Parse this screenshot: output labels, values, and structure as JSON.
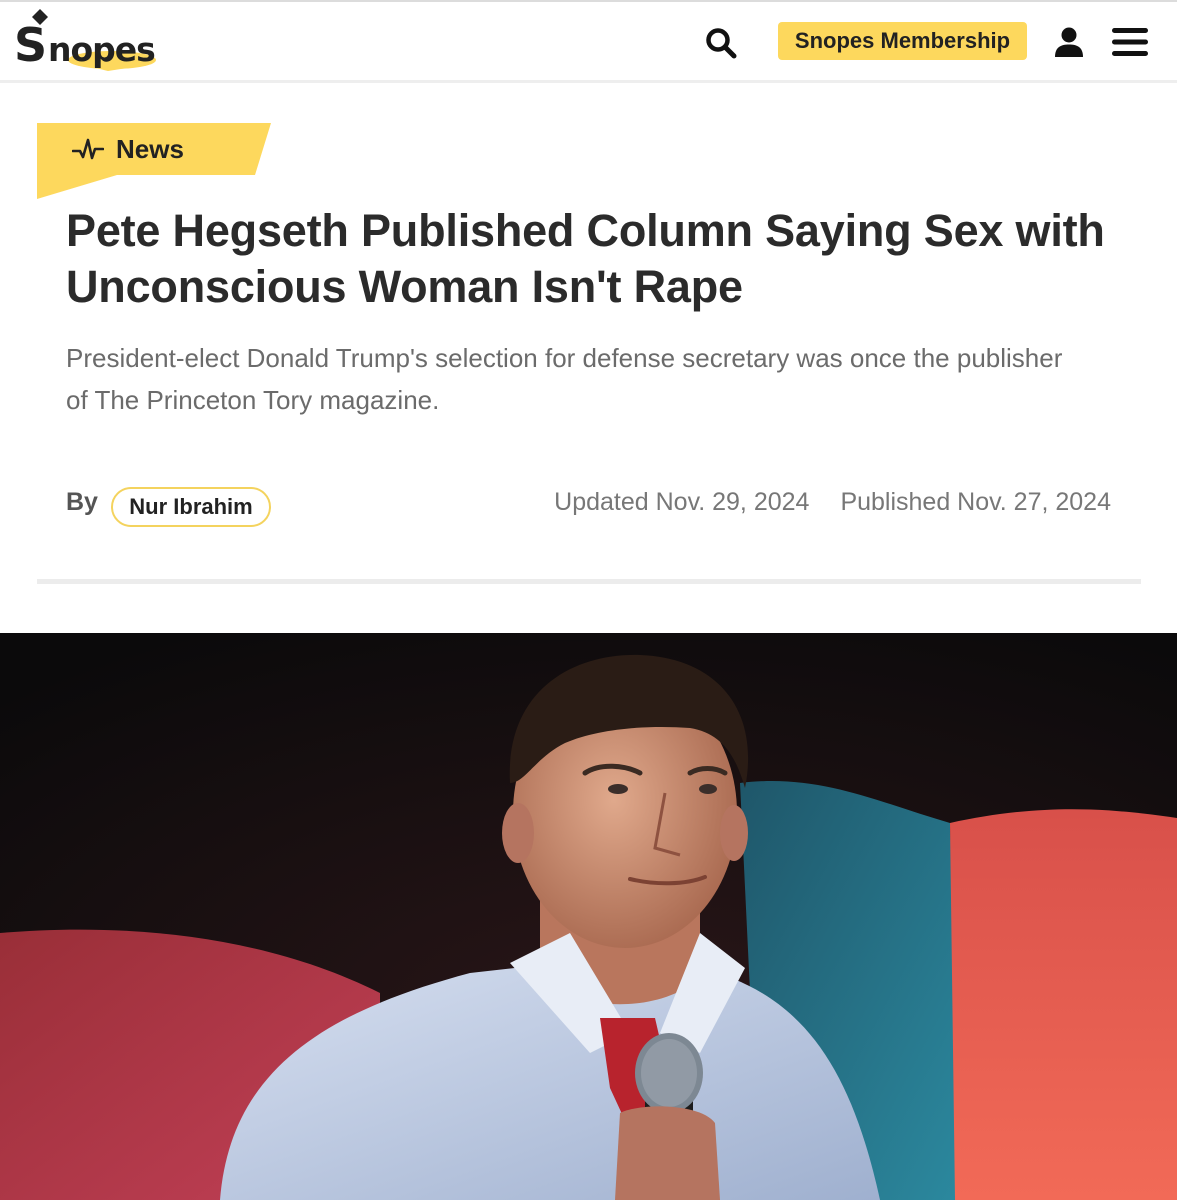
{
  "header": {
    "logo_text": "Snopes",
    "membership_label": "Snopes Membership",
    "icons": {
      "search": "search-icon",
      "user": "user-icon",
      "menu": "hamburger-menu-icon"
    }
  },
  "colors": {
    "accent": "#fdd85d",
    "title": "#2b2b2b",
    "subtitle": "#6b6b6b"
  },
  "article": {
    "category": "News",
    "category_icon": "pulse-icon",
    "title": "Pete Hegseth Published Column Saying Sex with Unconscious Woman Isn't Rape",
    "subtitle": "President-elect Donald Trump's selection for defense secretary was once the publisher of The Princeton Tory magazine.",
    "by_label": "By",
    "author": "Nur Ibrahim",
    "updated": "Updated Nov. 29, 2024",
    "published": "Published Nov. 27, 2024"
  }
}
